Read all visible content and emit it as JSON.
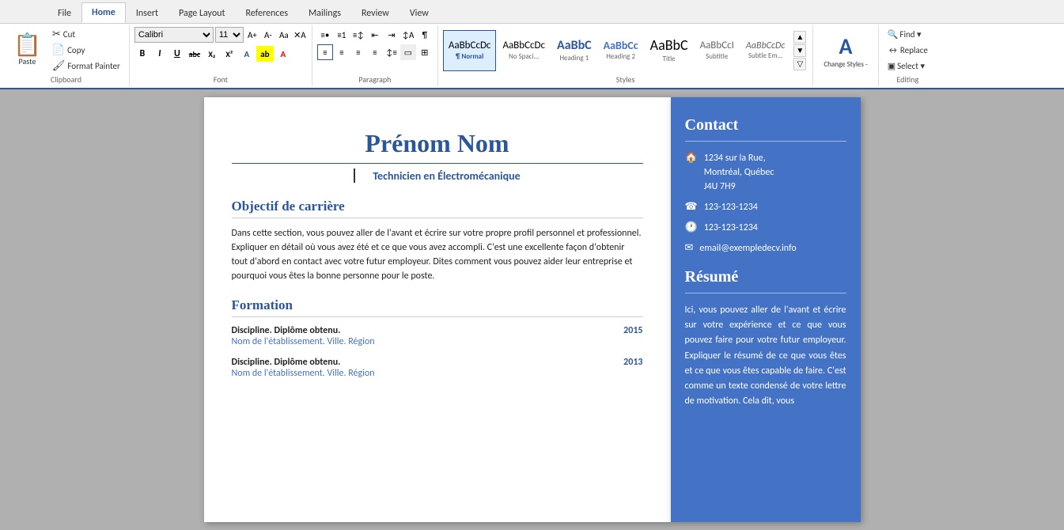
{
  "ribbon": {
    "tabs": [
      "File",
      "Home",
      "Insert",
      "Page Layout",
      "References",
      "Mailings",
      "Review",
      "View"
    ],
    "active_tab": "Home",
    "groups": {
      "clipboard": {
        "label": "Clipboard",
        "paste": "Paste",
        "cut": "Cut",
        "copy": "Copy",
        "format_painter": "Format Painter"
      },
      "font": {
        "label": "Font",
        "font_name": "Calibri",
        "font_size": "11",
        "bold": "B",
        "italic": "I",
        "underline": "U",
        "strikethrough": "abc",
        "subscript": "X₂",
        "superscript": "X²"
      },
      "paragraph": {
        "label": "Paragraph"
      },
      "styles": {
        "label": "Styles",
        "items": [
          {
            "name": "Normal",
            "preview": "AaBbCcDc",
            "active": true
          },
          {
            "name": "No Spaci...",
            "preview": "AaBbCcDc"
          },
          {
            "name": "Heading 1",
            "preview": "AaBbC"
          },
          {
            "name": "Heading 2",
            "preview": "AaBbCc"
          },
          {
            "name": "Title",
            "preview": "AaBbC"
          },
          {
            "name": "Subtitle",
            "preview": "AaBbCcI"
          },
          {
            "name": "Subtle Em...",
            "preview": "AaBbCcDc"
          }
        ]
      },
      "change_styles": {
        "label": "Change Styles -",
        "icon": "A"
      },
      "editing": {
        "label": "Editing",
        "find": "Find ▾",
        "replace": "Replace",
        "select": "Select ▾"
      }
    }
  },
  "document": {
    "name": "Prénom Nom",
    "subtitle": "Technicien en Électromécanique",
    "sections": [
      {
        "title": "Objectif de carrière",
        "body": "Dans cette section, vous pouvez aller de l'avant et écrire sur votre propre profil personnel et professionnel. Expliquer en détail où vous avez été et ce que vous avez accompli. C'est une excellente façon d'obtenir tout d'abord en contact avec votre futur employeur. Dites comment vous pouvez aider leur entreprise et pourquoi vous êtes la bonne personne pour le poste."
      },
      {
        "title": "Formation",
        "education": [
          {
            "degree": "Discipline. Diplôme obtenu.",
            "year": "2015",
            "school": "Nom de l'établissement. Ville. Région"
          },
          {
            "degree": "Discipline. Diplôme obtenu.",
            "year": "2013",
            "school": "Nom de l'établissement. Ville. Région"
          }
        ]
      }
    ]
  },
  "sidebar": {
    "sections": [
      {
        "title": "Contact",
        "items": [
          {
            "icon": "🏠",
            "text": "1234 sur la Rue,\nMontréal, Québec\nJ4U 7H9"
          },
          {
            "icon": "📞",
            "text": "123-123-1234"
          },
          {
            "icon": "🕐",
            "text": "123-123-1234"
          },
          {
            "icon": "✉",
            "text": "email@exempledecv.info"
          }
        ]
      },
      {
        "title": "Résumé",
        "body": "Ici, vous pouvez aller de l'avant et écrire sur votre expérience et ce que vous pouvez faire pour votre futur employeur. Expliquer le résumé de ce que vous êtes et ce que vous êtes capable de faire. C'est comme un texte condensé de votre lettre de motivation. Cela dit, vous"
      }
    ]
  }
}
